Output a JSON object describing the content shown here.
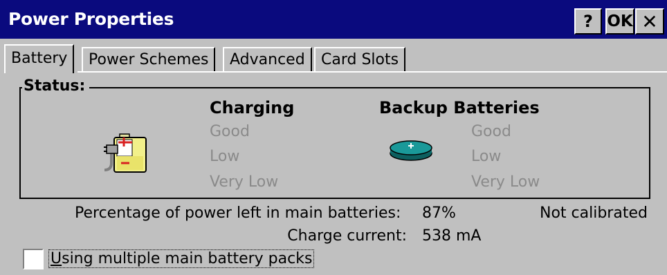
{
  "window": {
    "title": "Power Properties",
    "help_label": "?",
    "ok_label": "OK",
    "close_label": "✕"
  },
  "tabs": [
    {
      "label": "Battery",
      "active": true
    },
    {
      "label": "Power Schemes",
      "active": false
    },
    {
      "label": "Advanced",
      "active": false
    },
    {
      "label": "Card Slots",
      "active": false
    }
  ],
  "status": {
    "group_label": "Status:",
    "charging": {
      "header": "Charging",
      "icon": "battery-charging-icon",
      "levels": [
        "Good",
        "Low",
        "Very Low"
      ]
    },
    "backup": {
      "header": "Backup Batteries",
      "icon": "coin-cell-battery-icon",
      "levels": [
        "Good",
        "Low",
        "Very Low"
      ]
    }
  },
  "info": {
    "percentage_label": "Percentage of power left in main batteries:",
    "percentage_value": "87%",
    "calibration": "Not calibrated",
    "charge_current_label": "Charge current:",
    "charge_current_value": "538 mA"
  },
  "multiple_packs": {
    "underlined_char": "U",
    "rest_label": "sing multiple main battery packs",
    "checked": false
  },
  "colors": {
    "titlebar": "#0a0a7e",
    "face": "#c0c0c0",
    "disabled_text": "#8a8a8a"
  }
}
